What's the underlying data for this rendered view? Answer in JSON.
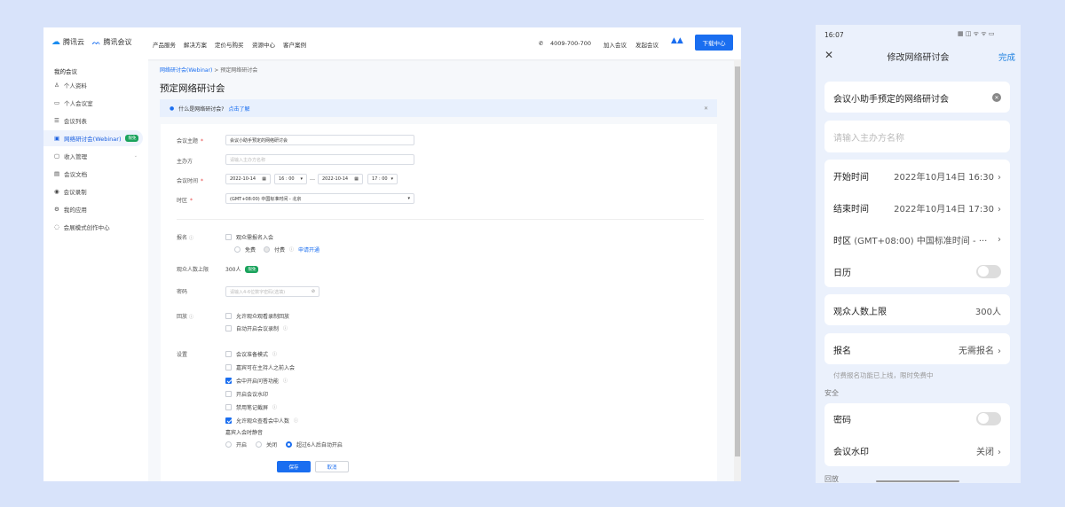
{
  "desktop": {
    "header": {
      "brand_cloud": "腾讯云",
      "brand_meeting": "腾讯会议",
      "nav": [
        "产品服务",
        "解决方案",
        "定价与购买",
        "资源中心",
        "客户案例"
      ],
      "phone": "4009-700-700",
      "join": "加入会议",
      "start": "发起会议",
      "download": "下载中心"
    },
    "sidebar": {
      "title": "我的会议",
      "items": [
        {
          "label": "个人资料",
          "icon": "user-icon"
        },
        {
          "label": "个人会议室",
          "icon": "monitor-icon"
        },
        {
          "label": "会议列表",
          "icon": "list-icon"
        },
        {
          "label": "网络研讨会(Webinar)",
          "icon": "webinar-icon",
          "badge": "限免",
          "active": true
        },
        {
          "label": "收入管理",
          "icon": "wallet-icon"
        },
        {
          "label": "会议文档",
          "icon": "doc-icon"
        },
        {
          "label": "会议录制",
          "icon": "record-icon"
        },
        {
          "label": "我的应用",
          "icon": "app-icon"
        },
        {
          "label": "会展模式创作中心",
          "icon": "creator-icon"
        }
      ]
    },
    "breadcrumb": [
      "网络研讨会(Webinar)",
      "预定网络研讨会"
    ],
    "page_title": "预定网络研讨会",
    "notice": {
      "text": "什么是网络研讨会?",
      "link": "点击了解"
    },
    "form": {
      "subject_label": "会议主题",
      "subject_value": "会议小助手预定的网络研讨会",
      "host_label": "主办方",
      "host_placeholder": "请输入主办方名称",
      "time_label": "会议时间",
      "start_date": "2022-10-14",
      "start_time": "16 : 00",
      "end_date": "2022-10-14",
      "end_time": "17 : 00",
      "tz_label": "时区",
      "tz_value": "(GMT+08:00) 中国标准时间 - 北京",
      "reg_label": "报名",
      "reg_check": "观众需报名入会",
      "free": "免费",
      "paid": "付费",
      "apply": "申请开通",
      "limit_label": "观众人数上限",
      "limit_value": "300人",
      "limit_badge": "限免",
      "pwd_label": "密码",
      "pwd_placeholder": "请输入4-6位数字密码(选填)",
      "replay_label": "回放",
      "replay_opts": [
        {
          "label": "允许观众观看录制回放",
          "checked": false
        },
        {
          "label": "自动开启会议录制",
          "checked": false
        }
      ],
      "settings_label": "设置",
      "settings_opts": [
        {
          "label": "会议准备模式",
          "checked": false
        },
        {
          "label": "嘉宾可在主持人之前入会",
          "checked": false
        },
        {
          "label": "会中开启问答功能",
          "checked": true
        },
        {
          "label": "开启会议水印",
          "checked": false
        },
        {
          "label": "禁用笔记截屏",
          "checked": false
        },
        {
          "label": "允许观众查看会中人数",
          "checked": true
        }
      ],
      "mute_label": "嘉宾入会时静音",
      "mute_opts": [
        "开启",
        "关闭",
        "超过6人后自动开启"
      ],
      "mute_selected": 2,
      "save": "保存",
      "cancel": "取消"
    }
  },
  "mobile": {
    "time": "16:07",
    "title": "修改网络研讨会",
    "done": "完成",
    "subject": "会议小助手预定的网络研讨会",
    "host_placeholder": "请输入主办方名称",
    "start_label": "开始时间",
    "start_value": "2022年10月14日 16:30",
    "end_label": "结束时间",
    "end_value": "2022年10月14日 17:30",
    "tz_label": "时区",
    "tz_value": "(GMT+08:00) 中国标准时间 - ···",
    "calendar_label": "日历",
    "calendar_on": false,
    "limit_label": "观众人数上限",
    "limit_value": "300人",
    "reg_label": "报名",
    "reg_value": "无需报名",
    "reg_hint": "付费报名功能已上线，限时免费中",
    "security_title": "安全",
    "pwd_label": "密码",
    "pwd_on": false,
    "watermark_label": "会议水印",
    "watermark_value": "关闭",
    "replay_title": "回放"
  },
  "colors": {
    "accent": "#1a6ef0",
    "badge": "#1aa35c"
  }
}
